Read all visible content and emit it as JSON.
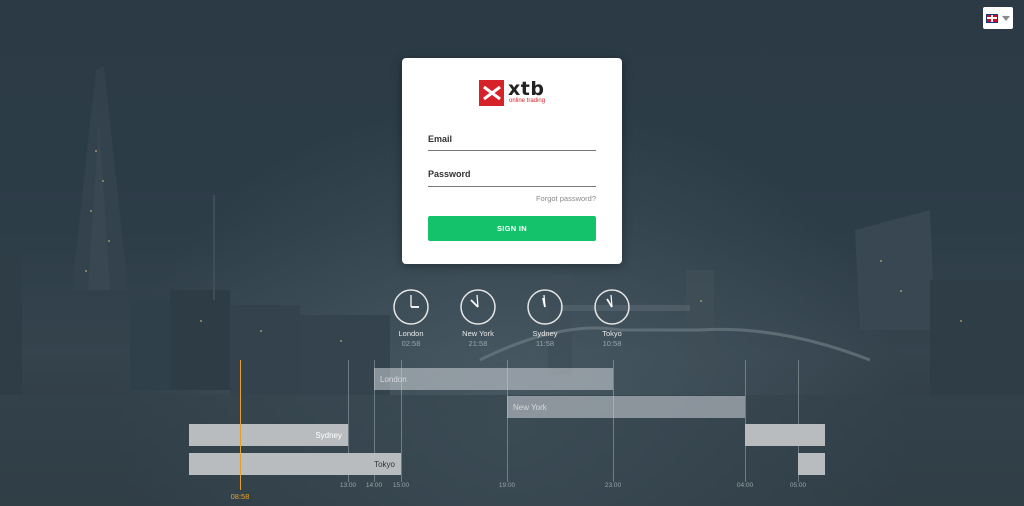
{
  "language": {
    "selected_icon": "uk-flag-icon"
  },
  "logo": {
    "word": "xtb",
    "tagline": "online trading",
    "brand_color": "#d6232a"
  },
  "login": {
    "email_label": "Email",
    "email_value": "",
    "password_label": "Password",
    "password_value": "",
    "forgot_label": "Forgot password?",
    "signin_label": "SIGN IN",
    "signin_color": "#13c26a"
  },
  "clocks": [
    {
      "city": "London",
      "time": "02:58"
    },
    {
      "city": "New York",
      "time": "21:58"
    },
    {
      "city": "Sydney",
      "time": "11:58"
    },
    {
      "city": "Tokyo",
      "time": "10:58"
    }
  ],
  "sessions": [
    {
      "name": "London"
    },
    {
      "name": "New York"
    },
    {
      "name": "Sydney"
    },
    {
      "name": "Tokyo"
    }
  ],
  "timeline": {
    "current_time": "08:58",
    "ticks": [
      "13:00",
      "14:00",
      "15:00",
      "19:00",
      "23:00",
      "04:00",
      "05:00"
    ]
  }
}
